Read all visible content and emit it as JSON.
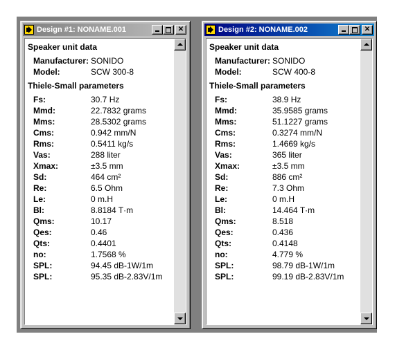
{
  "windows": [
    {
      "title": "Design #1: NONAME.001",
      "active": false,
      "speaker_heading": "Speaker unit data",
      "manufacturer_label": "Manufacturer:",
      "manufacturer": "SONIDO",
      "model_label": "Model:",
      "model": "SCW 300-8",
      "ts_heading": "Thiele-Small parameters",
      "params": [
        {
          "label": "Fs:",
          "value": "30.7 Hz"
        },
        {
          "label": "Mmd:",
          "value": "22.7832 grams"
        },
        {
          "label": "Mms:",
          "value": "28.5302 grams"
        },
        {
          "label": "Cms:",
          "value": "0.942 mm/N"
        },
        {
          "label": "Rms:",
          "value": "0.5411 kg/s"
        },
        {
          "label": "Vas:",
          "value": "288 liter"
        },
        {
          "label": "Xmax:",
          "value": "±3.5 mm"
        },
        {
          "label": "Sd:",
          "value": "464 cm²"
        },
        {
          "label": "Re:",
          "value": "6.5 Ohm"
        },
        {
          "label": "Le:",
          "value": "0 m.H"
        },
        {
          "label": "Bl:",
          "value": "8.8184 T·m"
        },
        {
          "label": "Qms:",
          "value": "10.17"
        },
        {
          "label": "Qes:",
          "value": "0.46"
        },
        {
          "label": "Qts:",
          "value": "0.4401"
        },
        {
          "label": "no:",
          "value": "1.7568 %"
        },
        {
          "label": "SPL:",
          "value": "94.45 dB-1W/1m"
        },
        {
          "label": "SPL:",
          "value": "95.35 dB-2.83V/1m"
        }
      ]
    },
    {
      "title": "Design #2: NONAME.002",
      "active": true,
      "speaker_heading": "Speaker unit data",
      "manufacturer_label": "Manufacturer:",
      "manufacturer": "SONIDO",
      "model_label": "Model:",
      "model": "SCW 400-8",
      "ts_heading": "Thiele-Small parameters",
      "params": [
        {
          "label": "Fs:",
          "value": "38.9 Hz"
        },
        {
          "label": "Mmd:",
          "value": "35.9585 grams"
        },
        {
          "label": "Mms:",
          "value": "51.1227 grams"
        },
        {
          "label": "Cms:",
          "value": "0.3274 mm/N"
        },
        {
          "label": "Rms:",
          "value": "1.4669 kg/s"
        },
        {
          "label": "Vas:",
          "value": "365 liter"
        },
        {
          "label": "Xmax:",
          "value": "±3.5 mm"
        },
        {
          "label": "Sd:",
          "value": "886 cm²"
        },
        {
          "label": "Re:",
          "value": "7.3 Ohm"
        },
        {
          "label": "Le:",
          "value": "0 m.H"
        },
        {
          "label": "Bl:",
          "value": "14.464 T·m"
        },
        {
          "label": "Qms:",
          "value": "8.518"
        },
        {
          "label": "Qes:",
          "value": "0.436"
        },
        {
          "label": "Qts:",
          "value": "0.4148"
        },
        {
          "label": "no:",
          "value": "4.779 %"
        },
        {
          "label": "SPL:",
          "value": "98.79 dB-1W/1m"
        },
        {
          "label": "SPL:",
          "value": "99.19 dB-2.83V/1m"
        }
      ]
    }
  ],
  "icons": {
    "app": "speaker-icon",
    "minimize": "minimize-icon",
    "maximize": "maximize-icon",
    "close": "close-icon",
    "scroll_up": "scroll-up-arrow-icon",
    "scroll_down": "scroll-down-arrow-icon"
  },
  "colors": {
    "active_title": "#000080",
    "inactive_title": "#808080",
    "desktop": "#808080",
    "chrome": "#c0c0c0"
  },
  "close_glyph": "✕"
}
